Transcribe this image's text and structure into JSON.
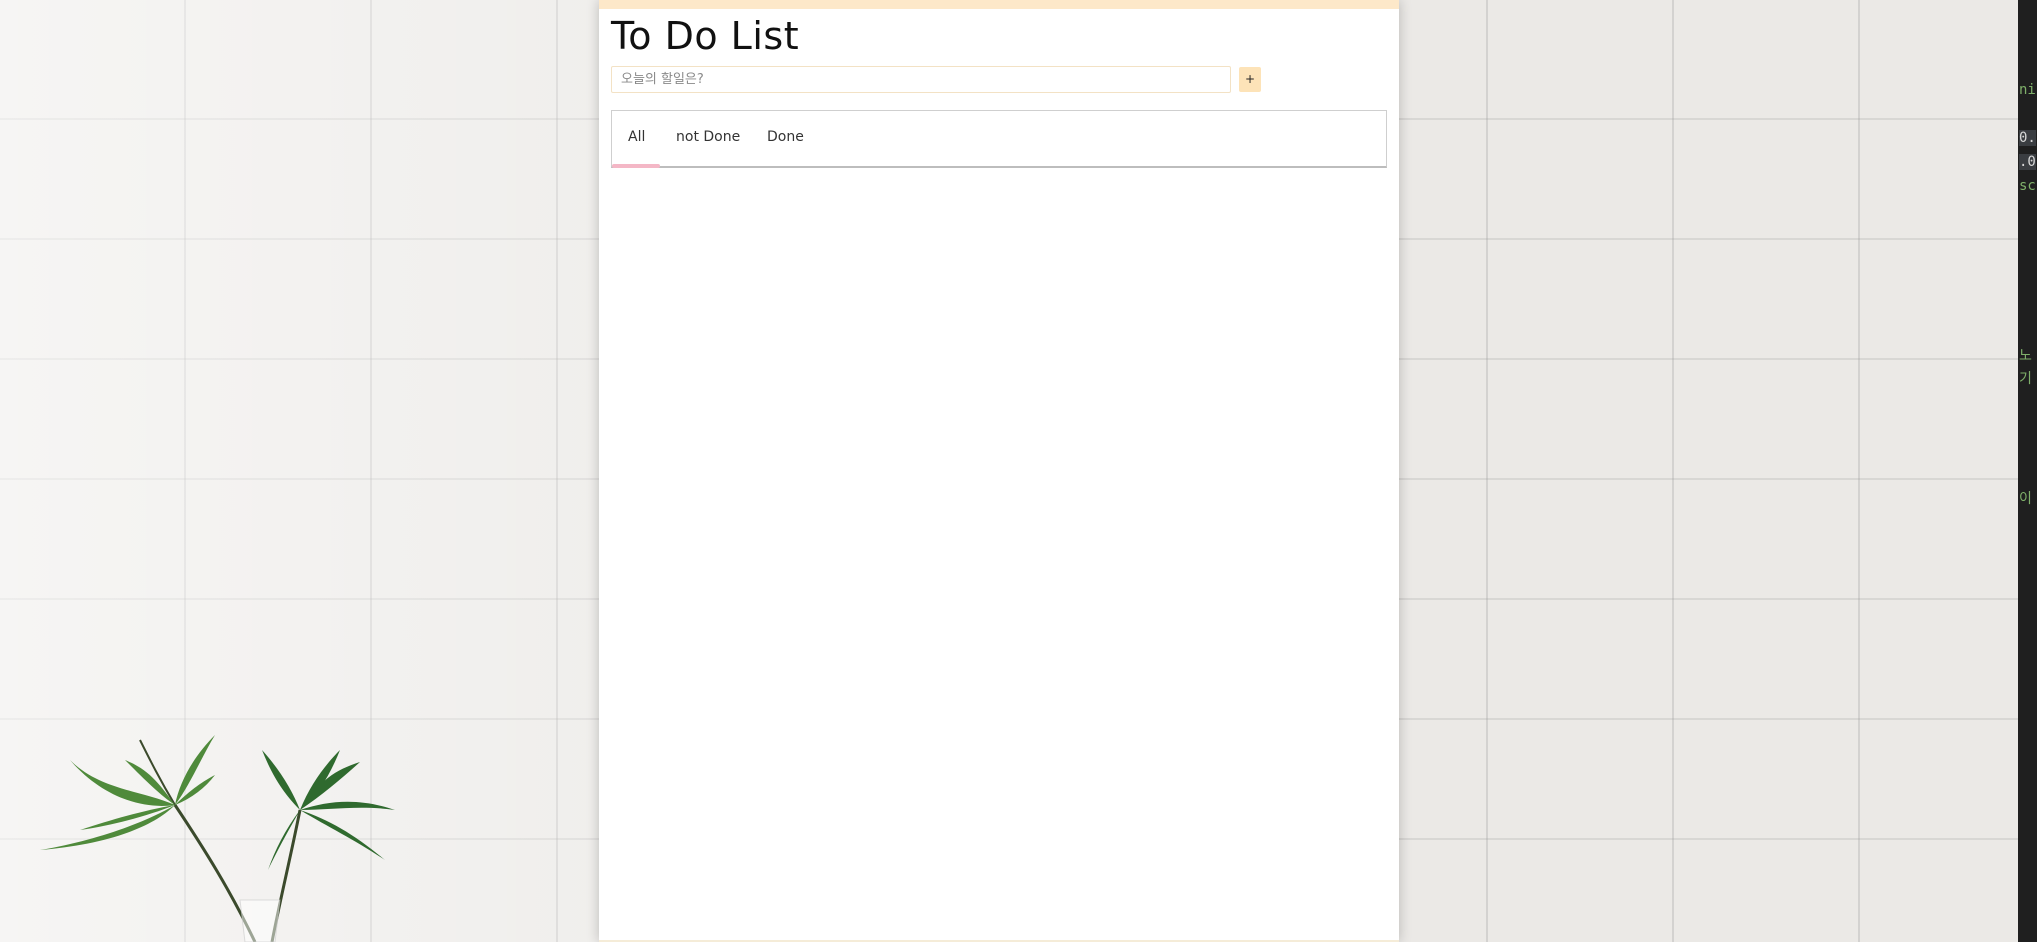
{
  "app": {
    "title": "To Do List"
  },
  "input": {
    "placeholder": "오늘의 할일은?",
    "value": ""
  },
  "add_button": {
    "label": "+"
  },
  "tabs": [
    {
      "label": "All",
      "active": true
    },
    {
      "label": "not Done",
      "active": false
    },
    {
      "label": "Done",
      "active": false
    }
  ],
  "tasks": [],
  "colors": {
    "accent_band": "#fde8c9",
    "add_button_bg": "#fde3b8",
    "tab_underline": "#f4b7c6"
  }
}
